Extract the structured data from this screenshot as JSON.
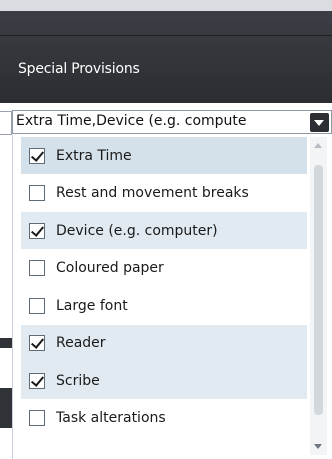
{
  "header": {
    "title": "Special Provisions"
  },
  "select": {
    "value": "Extra Time,Device (e.g. compute",
    "arrow_icon": "chevron-down-icon"
  },
  "options": [
    {
      "label": "Extra Time",
      "checked": true
    },
    {
      "label": "Rest and movement breaks",
      "checked": false
    },
    {
      "label": "Device (e.g. computer)",
      "checked": true
    },
    {
      "label": "Coloured paper",
      "checked": false
    },
    {
      "label": "Large font",
      "checked": false
    },
    {
      "label": "Reader",
      "checked": true
    },
    {
      "label": "Scribe",
      "checked": true
    },
    {
      "label": "Task alterations",
      "checked": false
    }
  ],
  "colors": {
    "header_bg": "#2f3236",
    "selected_row": "#e1eaf1",
    "border": "#8e9aa6"
  }
}
